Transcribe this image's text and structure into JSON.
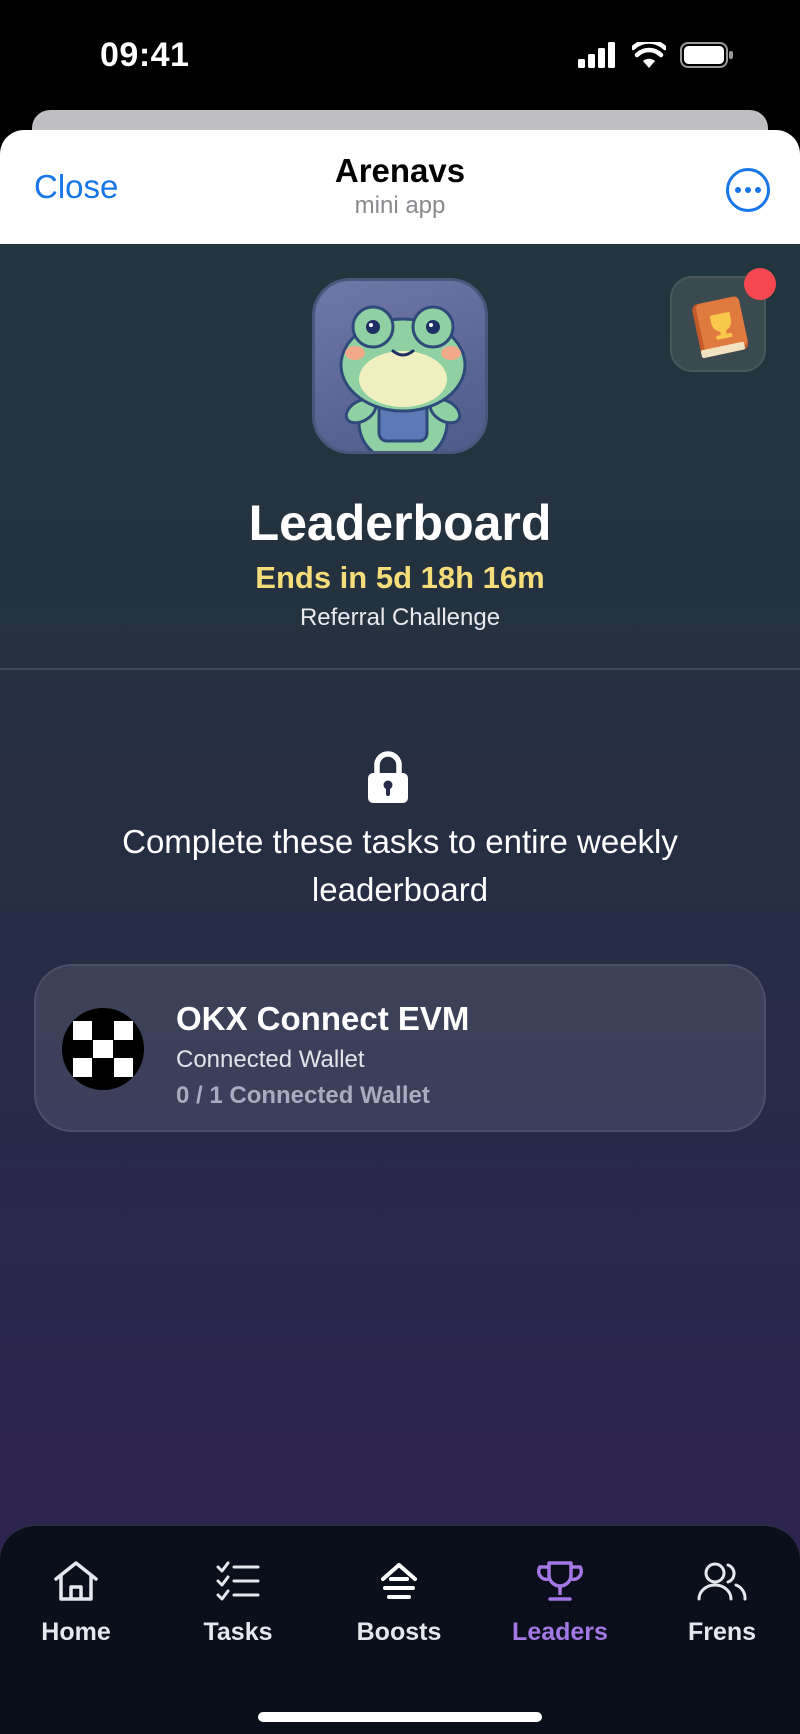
{
  "status_bar": {
    "time": "09:41"
  },
  "header": {
    "close_label": "Close",
    "title": "Arenavs",
    "subtitle": "mini app"
  },
  "hero": {
    "title": "Leaderboard",
    "ends_text": "Ends in 5d 18h 16m",
    "subtitle": "Referral Challenge",
    "notification_color": "#f5474f"
  },
  "locked": {
    "message": "Complete these tasks to entire weekly leaderboard"
  },
  "tasks": [
    {
      "name": "OKX Connect EVM",
      "description": "Connected Wallet",
      "progress": "0 / 1 Connected Wallet"
    }
  ],
  "nav": {
    "items": [
      {
        "label": "Home",
        "icon": "home-icon"
      },
      {
        "label": "Tasks",
        "icon": "checklist-icon"
      },
      {
        "label": "Boosts",
        "icon": "boost-icon"
      },
      {
        "label": "Leaders",
        "icon": "trophy-icon",
        "active": true
      },
      {
        "label": "Frens",
        "icon": "friends-icon"
      }
    ],
    "active_color": "#a477e6"
  },
  "colors": {
    "accent_blue": "#1877e8",
    "highlight_yellow": "#f7dd79"
  }
}
